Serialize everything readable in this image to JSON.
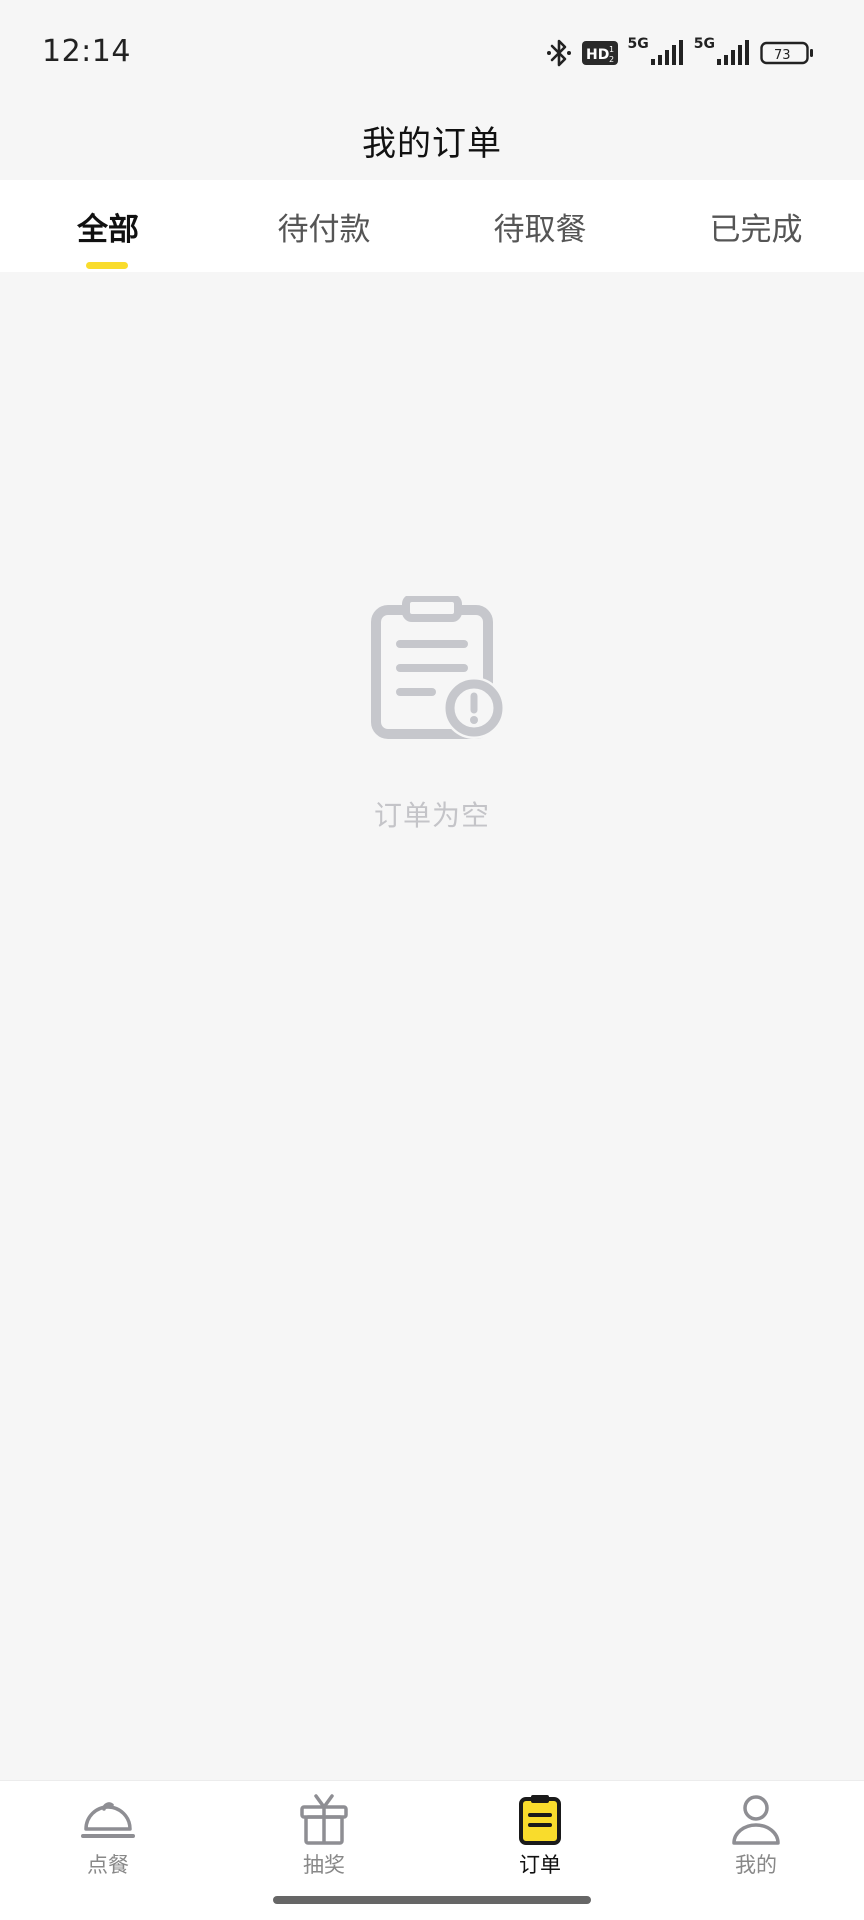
{
  "status_bar": {
    "time": "12:14",
    "hd_label": "HD",
    "network_1": "5G",
    "network_2": "5G",
    "battery": "73"
  },
  "header": {
    "title": "我的订单"
  },
  "tabs": [
    {
      "label": "全部",
      "active": true
    },
    {
      "label": "待付款",
      "active": false
    },
    {
      "label": "待取餐",
      "active": false
    },
    {
      "label": "已完成",
      "active": false
    }
  ],
  "empty_state": {
    "icon": "clipboard-alert-icon",
    "message": "订单为空"
  },
  "bottom_nav": [
    {
      "label": "点餐",
      "icon": "cloche-icon",
      "active": false
    },
    {
      "label": "抽奖",
      "icon": "gift-icon",
      "active": false
    },
    {
      "label": "订单",
      "icon": "clipboard-icon",
      "active": true
    },
    {
      "label": "我的",
      "icon": "person-icon",
      "active": false
    }
  ],
  "colors": {
    "accent": "#f9dc2c",
    "background": "#f6f6f6",
    "icon_gray": "#c6c7cc",
    "nav_inactive": "#888888"
  }
}
